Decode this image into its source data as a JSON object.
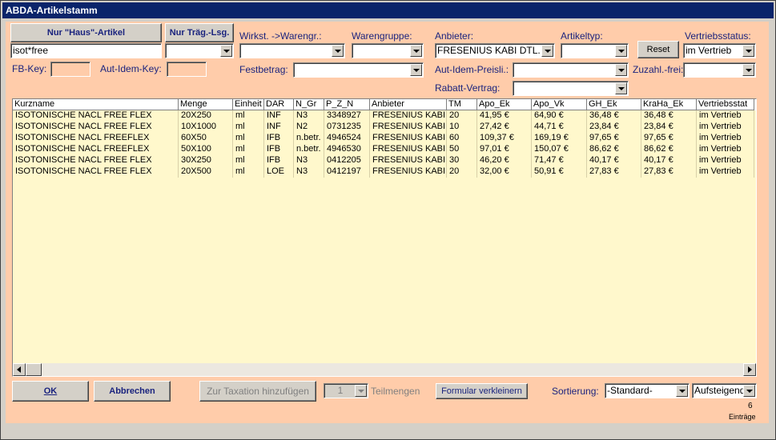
{
  "window": {
    "title": "ABDA-Artikelstamm"
  },
  "buttons": {
    "nur_haus": "Nur \"Haus\"-Artikel",
    "nur_traeg": "Nur Träg.-Lsg.",
    "reset": "Reset",
    "ok": "OK",
    "abbrechen": "Abbrechen",
    "zur_taxation": "Zur Taxation hinzufügen",
    "formular": "Formular verkleinern"
  },
  "filters": {
    "search_value": "isot*free",
    "wirkst_label": "Wirkst. ->Warengr.:",
    "warengruppe_label": "Warengruppe:",
    "anbieter_label": "Anbieter:",
    "anbieter_value": "FRESENIUS KABI DTL.",
    "artikeltyp_label": "Artikeltyp:",
    "vertrieb_label": "Vertriebsstatus:",
    "vertrieb_value": "im Vertrieb",
    "fbkey_label": "FB-Key:",
    "autidem_key_label": "Aut-Idem-Key:",
    "festbetrag_label": "Festbetrag:",
    "autidem_preis_label": "Aut-Idem-Preisli.:",
    "zuzahl_label": "Zuzahl.-frei:",
    "rabatt_label": "Rabatt-Vertrag:"
  },
  "table": {
    "columns": [
      "Kurzname",
      "Menge",
      "Einheit",
      "DAR",
      "N_Gr",
      "P_Z_N",
      "Anbieter",
      "TM",
      "Apo_Ek",
      "Apo_Vk",
      "GH_Ek",
      "KraHa_Ek",
      "Vertriebsstat"
    ],
    "rows": [
      [
        "ISOTONISCHE NACL FREE FLEX",
        "20X250",
        "ml",
        "INF",
        "N3",
        "3348927",
        "FRESENIUS KABI",
        "20",
        "41,95 €",
        "64,90 €",
        "36,48 €",
        "36,48 €",
        "im Vertrieb"
      ],
      [
        "ISOTONISCHE NACL FREE FLEX",
        "10X1000",
        "ml",
        "INF",
        "N2",
        "0731235",
        "FRESENIUS KABI",
        "10",
        "27,42 €",
        "44,71 €",
        "23,84 €",
        "23,84 €",
        "im Vertrieb"
      ],
      [
        "ISOTONISCHE NACL FREEFLEX",
        "60X50",
        "ml",
        "IFB",
        "n.betr.",
        "4946524",
        "FRESENIUS KABI",
        "60",
        "109,37 €",
        "169,19 €",
        "97,65 €",
        "97,65 €",
        "im Vertrieb"
      ],
      [
        "ISOTONISCHE NACL FREEFLEX",
        "50X100",
        "ml",
        "IFB",
        "n.betr.",
        "4946530",
        "FRESENIUS KABI",
        "50",
        "97,01 €",
        "150,07 €",
        "86,62 €",
        "86,62 €",
        "im Vertrieb"
      ],
      [
        "ISOTONISCHE NACL FREE FLEX",
        "30X250",
        "ml",
        "IFB",
        "N3",
        "0412205",
        "FRESENIUS KABI",
        "30",
        "46,20 €",
        "71,47 €",
        "40,17 €",
        "40,17 €",
        "im Vertrieb"
      ],
      [
        "ISOTONISCHE NACL FREE FLEX",
        "20X500",
        "ml",
        "LOE",
        "N3",
        "0412197",
        "FRESENIUS KABI",
        "20",
        "32,00 €",
        "50,91 €",
        "27,83 €",
        "27,83 €",
        "im Vertrieb"
      ]
    ]
  },
  "footer": {
    "teilmengen_value": "1",
    "teilmengen_label": "Teilmengen",
    "sortierung_label": "Sortierung:",
    "sortierung_value": "-Standard-",
    "order_value": "Aufsteigend",
    "count": "6",
    "count_label": "Einträge"
  }
}
